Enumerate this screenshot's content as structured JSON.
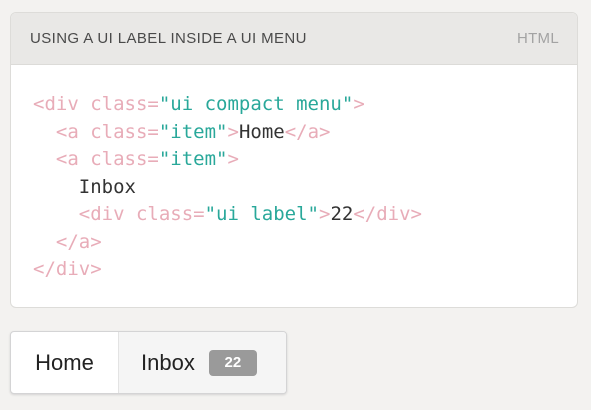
{
  "example": {
    "title": "USING A UI LABEL INSIDE A UI MENU",
    "language": "HTML"
  },
  "code_lines": [
    [
      {
        "t": "<div ",
        "k": "tg"
      },
      {
        "t": "class=",
        "k": "at"
      },
      {
        "t": "\"ui compact menu\"",
        "k": "st"
      },
      {
        "t": ">",
        "k": "tg"
      }
    ],
    [
      {
        "t": "  ",
        "k": "tx"
      },
      {
        "t": "<a ",
        "k": "tg"
      },
      {
        "t": "class=",
        "k": "at"
      },
      {
        "t": "\"item\"",
        "k": "st"
      },
      {
        "t": ">",
        "k": "tg"
      },
      {
        "t": "Home",
        "k": "tx"
      },
      {
        "t": "</a>",
        "k": "tg"
      }
    ],
    [
      {
        "t": "  ",
        "k": "tx"
      },
      {
        "t": "<a ",
        "k": "tg"
      },
      {
        "t": "class=",
        "k": "at"
      },
      {
        "t": "\"item\"",
        "k": "st"
      },
      {
        "t": ">",
        "k": "tg"
      }
    ],
    [
      {
        "t": "    Inbox",
        "k": "tx"
      }
    ],
    [
      {
        "t": "    ",
        "k": "tx"
      },
      {
        "t": "<div ",
        "k": "tg"
      },
      {
        "t": "class=",
        "k": "at"
      },
      {
        "t": "\"ui label\"",
        "k": "st"
      },
      {
        "t": ">",
        "k": "tg"
      },
      {
        "t": "22",
        "k": "tx"
      },
      {
        "t": "</div>",
        "k": "tg"
      }
    ],
    [
      {
        "t": "  ",
        "k": "tx"
      },
      {
        "t": "</a>",
        "k": "tg"
      }
    ],
    [
      {
        "t": "</div>",
        "k": "tg"
      }
    ]
  ],
  "menu": {
    "items": [
      {
        "label": "Home"
      },
      {
        "label": "Inbox",
        "badge": "22"
      }
    ]
  },
  "colors": {
    "code_tag": "#e8acb8",
    "code_string": "#29a89a",
    "code_text": "#333333",
    "label_bg": "#9a9a9a"
  }
}
